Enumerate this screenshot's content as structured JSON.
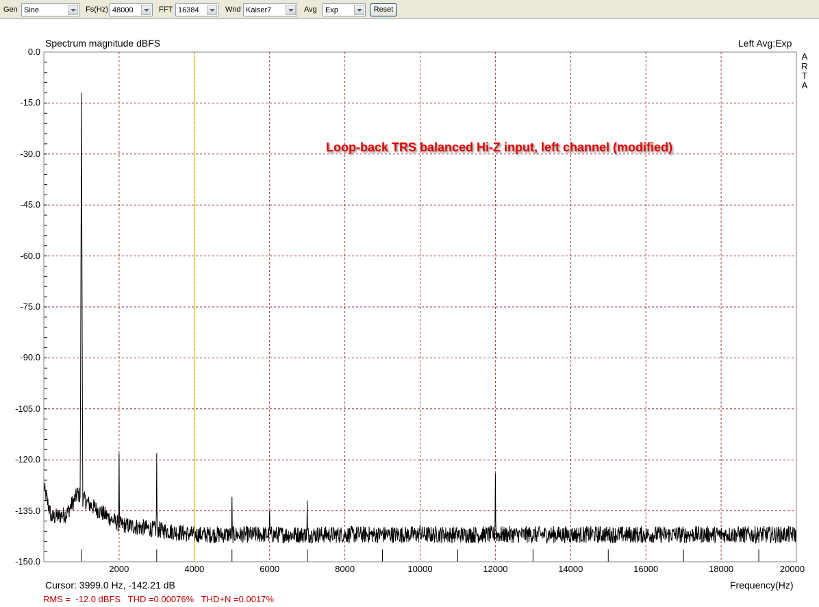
{
  "toolbar": {
    "gen_label": "Gen",
    "gen_value": "Sine",
    "fs_label": "Fs(Hz)",
    "fs_value": "48000",
    "fft_label": "FFT",
    "fft_value": "16384",
    "wnd_label": "Wnd",
    "wnd_value": "Kaiser7",
    "avg_label": "Avg",
    "avg_value": "Exp",
    "reset_label": "Reset"
  },
  "plot": {
    "title": "Spectrum magnitude dBFS",
    "channel_info": "Left  Avg:Exp",
    "brand_letters": [
      "A",
      "R",
      "T",
      "A"
    ],
    "annotation": "Loop-back TRS balanced Hi-Z input, left channel (modified)",
    "cursor_readout": "Cursor:  3999.0 Hz, -142.21 dB",
    "measurements": "RMS =  -12.0 dBFS   THD =0.00076%   THD+N =0.0017%",
    "trace_color": "#000000",
    "grid_color": "#a03030",
    "cursor_color": "#c8c800",
    "annotation_color": "#e00000"
  },
  "chart_data": {
    "type": "line",
    "title": "Spectrum magnitude dBFS",
    "xlabel": "Frequency(Hz)",
    "ylabel": "",
    "xlim": [
      0,
      20000
    ],
    "ylim": [
      -150,
      0
    ],
    "grid": true,
    "x_ticks": [
      "2000",
      "4000",
      "6000",
      "8000",
      "10000",
      "12000",
      "14000",
      "16000",
      "18000",
      "20000"
    ],
    "y_ticks": [
      "0.0",
      "-15.0",
      "-30.0",
      "-45.0",
      "-60.0",
      "-75.0",
      "-90.0",
      "-105.0",
      "-120.0",
      "-135.0",
      "-150.0"
    ],
    "cursor_x": 3999.0,
    "noise_floor_db": -142,
    "peaks": [
      {
        "freq": 1000,
        "db": -12
      },
      {
        "freq": 2000,
        "db": -118
      },
      {
        "freq": 3000,
        "db": -118
      },
      {
        "freq": 5000,
        "db": -131
      },
      {
        "freq": 6000,
        "db": -135
      },
      {
        "freq": 7000,
        "db": -132
      },
      {
        "freq": 10000,
        "db": -139
      },
      {
        "freq": 12000,
        "db": -124
      }
    ],
    "low_freq_floor": [
      {
        "freq": 0,
        "db": -128
      },
      {
        "freq": 200,
        "db": -137
      },
      {
        "freq": 600,
        "db": -136
      },
      {
        "freq": 900,
        "db": -130
      },
      {
        "freq": 1200,
        "db": -133
      },
      {
        "freq": 2000,
        "db": -139
      },
      {
        "freq": 4000,
        "db": -142
      }
    ]
  }
}
